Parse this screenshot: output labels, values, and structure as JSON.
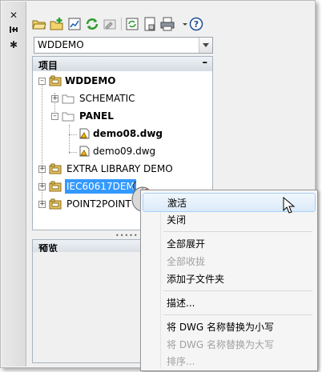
{
  "palette": {
    "title_icons": [
      "close-icon",
      "pin-icon",
      "settings-icon"
    ]
  },
  "toolbar": {
    "buttons": [
      {
        "name": "open-project-icon"
      },
      {
        "name": "new-project-icon"
      },
      {
        "name": "project-properties-icon"
      },
      {
        "name": "refresh-icon"
      },
      {
        "name": "describe-icon"
      },
      {
        "name": "update-icon"
      },
      {
        "name": "titleblock-icon"
      },
      {
        "name": "plot-icon"
      },
      {
        "name": "dropdown-arrow-icon"
      },
      {
        "name": "help-icon"
      }
    ]
  },
  "project_selector": {
    "value": "WDDEMO"
  },
  "projects_section": {
    "title": "项目",
    "collapse": "–"
  },
  "tree": {
    "root": "WDDEMO",
    "schematic": "SCHEMATIC",
    "panel": "PANEL",
    "file1": "demo08.dwg",
    "file2": "demo09.dwg",
    "extra": "EXTRA LIBRARY DEMO",
    "iec": "IEC60617DEM",
    "point2point": "POINT2POINT"
  },
  "preview_section": {
    "title": "预览"
  },
  "splitter": {
    "grip": "•••••"
  },
  "context_menu": {
    "items": [
      {
        "label": "激活",
        "state": "highlighted"
      },
      {
        "label": "关闭",
        "state": "enabled"
      },
      {
        "label": "全部展开",
        "state": "enabled"
      },
      {
        "label": "全部收拢",
        "state": "disabled"
      },
      {
        "label": "添加子文件夹",
        "state": "enabled"
      },
      {
        "label": "描述...",
        "state": "enabled"
      },
      {
        "label": "将 DWG 名称替换为小写",
        "state": "enabled"
      },
      {
        "label": "将 DWG 名称替换为大写",
        "state": "disabled"
      },
      {
        "label": "排序...",
        "state": "disabled"
      }
    ]
  },
  "colors": {
    "selection": "#3399ff",
    "menu_highlight_border": "#a8d0f5"
  }
}
